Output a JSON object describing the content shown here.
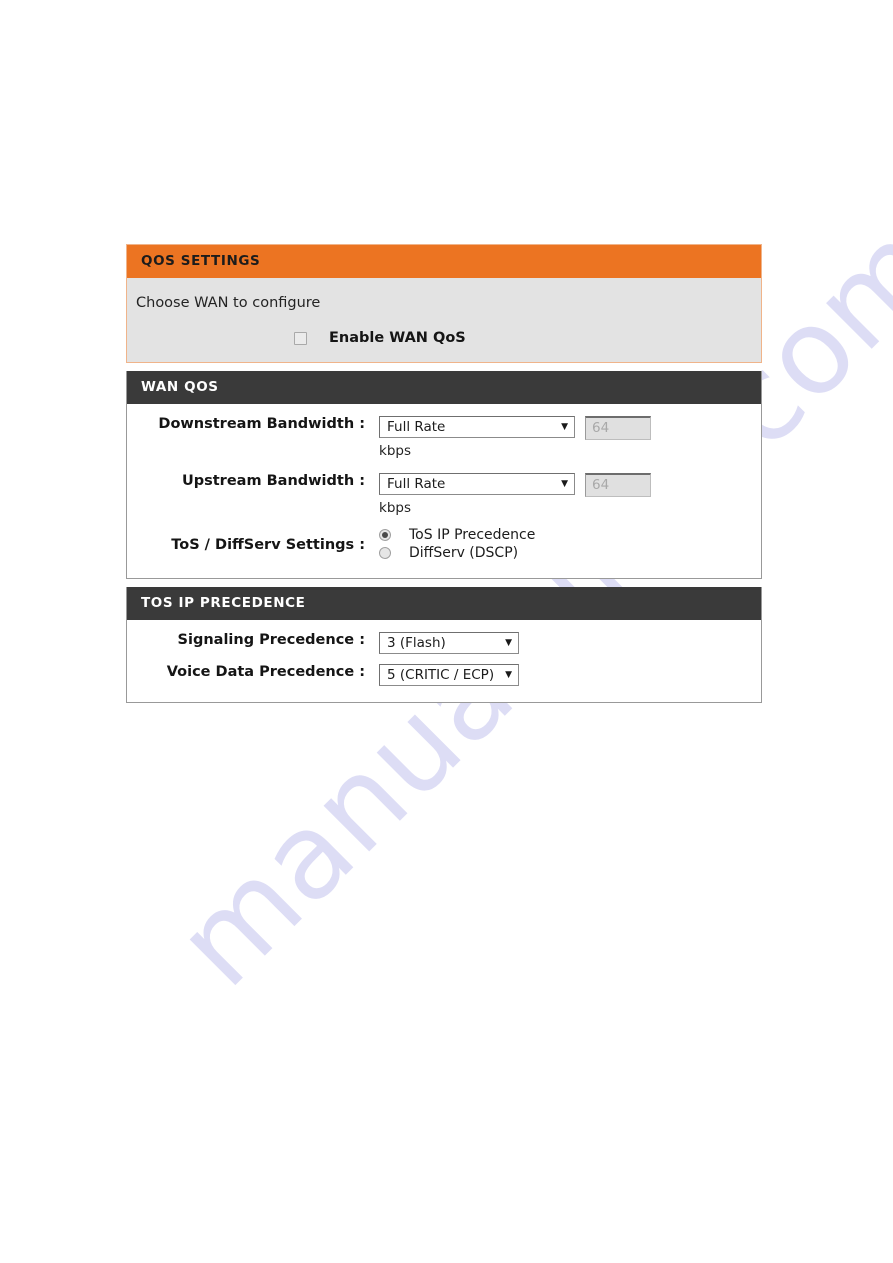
{
  "watermark": {
    "text": "manualslive.com"
  },
  "qos_settings_panel": {
    "header": "QOS SETTINGS",
    "intro_text": "Choose WAN to configure",
    "enable_checkbox": {
      "label": "Enable WAN QoS",
      "checked": false
    }
  },
  "wan_qos_panel": {
    "header": "WAN QOS",
    "rows": {
      "downstream": {
        "label": "Downstream Bandwidth :",
        "select_value": "Full Rate",
        "input_placeholder": "64",
        "input_value": "64",
        "input_disabled": true,
        "unit": "kbps"
      },
      "upstream": {
        "label": "Upstream Bandwidth :",
        "select_value": "Full Rate",
        "input_placeholder": "64",
        "input_value": "64",
        "input_disabled": true,
        "unit": "kbps"
      },
      "tos_diffserv": {
        "label": "ToS / DiffServ Settings :",
        "option_tos": "ToS IP Precedence",
        "option_diffserv": "DiffServ (DSCP)",
        "selected": "ToS IP Precedence"
      }
    }
  },
  "tos_ip_precedence_panel": {
    "header": "TOS IP PRECEDENCE",
    "rows": {
      "signaling": {
        "label": "Signaling Precedence :",
        "select_value": "3 (Flash)"
      },
      "voice_data": {
        "label": "Voice Data Precedence :",
        "select_value": "5 (CRITIC / ECP)"
      }
    }
  },
  "icons": {
    "dropdown_arrow": "▼"
  },
  "colors": {
    "orange_header": "#ec7422",
    "dark_header": "#3a3a3a",
    "gray_body": "#e3e3e3",
    "orange_border": "#f0b48a",
    "watermark": "#c9c9ef"
  }
}
